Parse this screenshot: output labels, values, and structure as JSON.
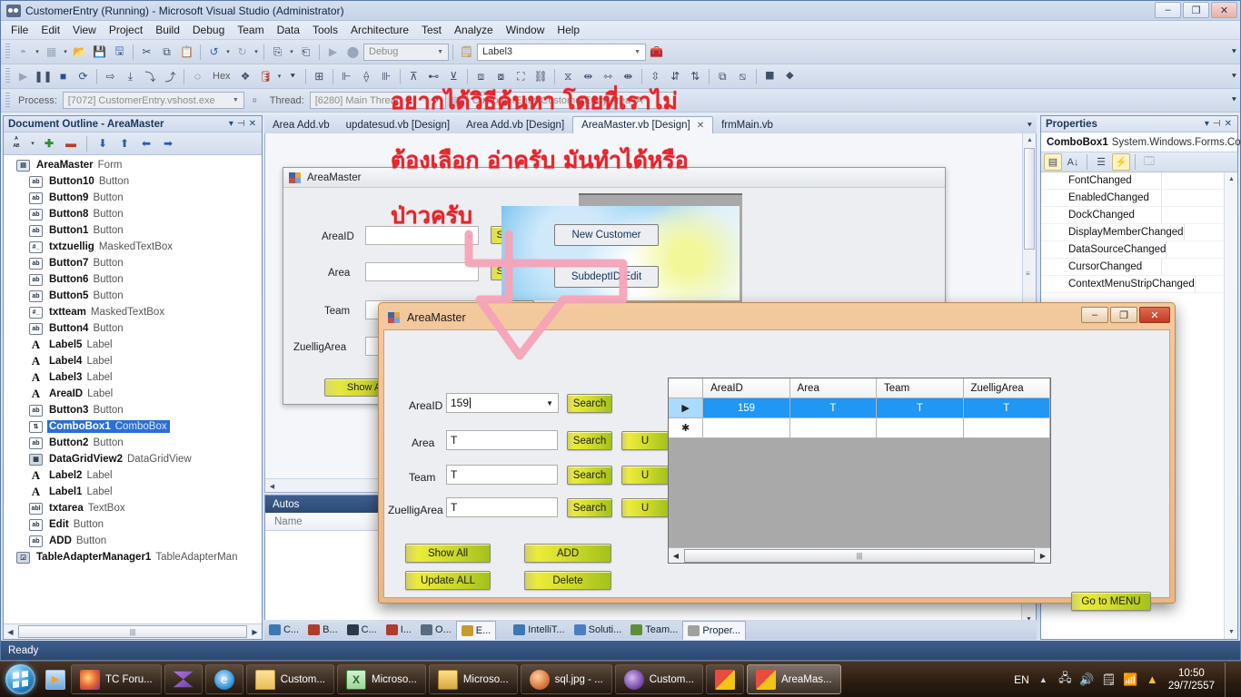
{
  "window": {
    "title": "CustomerEntry (Running) - Microsoft Visual Studio (Administrator)",
    "minimize": "–",
    "restore": "❐",
    "close": "✕"
  },
  "menubar": [
    "File",
    "Edit",
    "View",
    "Project",
    "Build",
    "Debug",
    "Team",
    "Data",
    "Tools",
    "Architecture",
    "Test",
    "Analyze",
    "Window",
    "Help"
  ],
  "toolbar_main": {
    "config_combo": "Debug",
    "target_combo": "Label3",
    "hex_label": "Hex"
  },
  "debug_bar": {
    "process_label": "Process:",
    "process_value": "[7072] CustomerEntry.vshost.exe",
    "thread_label": "Thread:",
    "thread_value": "[6280] Main Thread",
    "stackframe_value": "CustomerEntry.CustomerEntry.Area_A"
  },
  "document_outline": {
    "title": "Document Outline - AreaMaster",
    "dropdown": "▾",
    "pin": "⊣",
    "close": "✕",
    "toolbar": [
      "AB-sort",
      "add",
      "remove",
      "move-down",
      "move-up",
      "move-left",
      "move-right"
    ],
    "nodes": [
      {
        "name": "AreaMaster",
        "type": "Form",
        "icon": "form",
        "level": 0,
        "selected": false
      },
      {
        "name": "Button10",
        "type": "Button",
        "icon": "ab",
        "level": 1,
        "selected": false
      },
      {
        "name": "Button9",
        "type": "Button",
        "icon": "ab",
        "level": 1,
        "selected": false
      },
      {
        "name": "Button8",
        "type": "Button",
        "icon": "ab",
        "level": 1,
        "selected": false
      },
      {
        "name": "Button1",
        "type": "Button",
        "icon": "ab",
        "level": 1,
        "selected": false
      },
      {
        "name": "txtzuellig",
        "type": "MaskedTextBox",
        "icon": "mask",
        "level": 1,
        "selected": false
      },
      {
        "name": "Button7",
        "type": "Button",
        "icon": "ab",
        "level": 1,
        "selected": false
      },
      {
        "name": "Button6",
        "type": "Button",
        "icon": "ab",
        "level": 1,
        "selected": false
      },
      {
        "name": "Button5",
        "type": "Button",
        "icon": "ab",
        "level": 1,
        "selected": false
      },
      {
        "name": "txtteam",
        "type": "MaskedTextBox",
        "icon": "mask",
        "level": 1,
        "selected": false
      },
      {
        "name": "Button4",
        "type": "Button",
        "icon": "ab",
        "level": 1,
        "selected": false
      },
      {
        "name": "Label5",
        "type": "Label",
        "icon": "A",
        "level": 1,
        "selected": false
      },
      {
        "name": "Label4",
        "type": "Label",
        "icon": "A",
        "level": 1,
        "selected": false
      },
      {
        "name": "Label3",
        "type": "Label",
        "icon": "A",
        "level": 1,
        "selected": false
      },
      {
        "name": "AreaID",
        "type": "Label",
        "icon": "A",
        "level": 1,
        "selected": false
      },
      {
        "name": "Button3",
        "type": "Button",
        "icon": "ab",
        "level": 1,
        "selected": false
      },
      {
        "name": "ComboBox1",
        "type": "ComboBox",
        "icon": "combo",
        "level": 1,
        "selected": true
      },
      {
        "name": "Button2",
        "type": "Button",
        "icon": "ab",
        "level": 1,
        "selected": false
      },
      {
        "name": "DataGridView2",
        "type": "DataGridView",
        "icon": "grid",
        "level": 1,
        "selected": false
      },
      {
        "name": "Label2",
        "type": "Label",
        "icon": "A",
        "level": 1,
        "selected": false
      },
      {
        "name": "Label1",
        "type": "Label",
        "icon": "A",
        "level": 1,
        "selected": false
      },
      {
        "name": "txtarea",
        "type": "TextBox",
        "icon": "abl",
        "level": 1,
        "selected": false
      },
      {
        "name": "Edit",
        "type": "Button",
        "icon": "ab",
        "level": 1,
        "selected": false
      },
      {
        "name": "ADD",
        "type": "Button",
        "icon": "ab",
        "level": 1,
        "selected": false
      },
      {
        "name": "TableAdapterManager1",
        "type": "TableAdapterMan",
        "icon": "tam",
        "level": 0,
        "selected": false
      }
    ]
  },
  "editor_tabs": [
    {
      "label": "Area Add.vb",
      "active": false,
      "closable": false
    },
    {
      "label": "updatesud.vb [Design]",
      "active": false,
      "closable": false
    },
    {
      "label": "Area Add.vb [Design]",
      "active": false,
      "closable": false
    },
    {
      "label": "AreaMaster.vb [Design]",
      "active": true,
      "closable": true,
      "close": "✕"
    },
    {
      "label": "frmMain.vb",
      "active": false,
      "closable": false
    }
  ],
  "designer_form": {
    "title": "AreaMaster",
    "labels": [
      "AreaID",
      "Area",
      "Team",
      "ZuelligArea"
    ],
    "search_buttons": [
      "Search",
      "Search",
      "Search",
      "Search"
    ],
    "show_all": "Show All",
    "picture_buttons": [
      "New Customer",
      "SubdeptID Edit"
    ]
  },
  "autos_panel": {
    "title": "Autos",
    "columns": [
      "Name"
    ]
  },
  "bottom_tabs": [
    {
      "label": "C...",
      "active": false,
      "color": "#3c78b4"
    },
    {
      "label": "B...",
      "active": false,
      "color": "#b03a2e"
    },
    {
      "label": "C...",
      "active": false,
      "color": "#2b3a4a"
    },
    {
      "label": "I...",
      "active": false,
      "color": "#b03a2e"
    },
    {
      "label": "O...",
      "active": false,
      "color": "#5b6b80"
    },
    {
      "label": "E...",
      "active": true,
      "color": "#c79a2b"
    },
    {
      "label": "IntelliT...",
      "active": false,
      "color": "#3c78b4"
    },
    {
      "label": "Soluti...",
      "active": false,
      "color": "#4a7ec0"
    },
    {
      "label": "Team...",
      "active": false,
      "color": "#5b8f3a"
    },
    {
      "label": "Proper...",
      "active": true,
      "color": "#a0a0a0"
    }
  ],
  "properties": {
    "title": "Properties",
    "dropdown": "▾",
    "pin": "⊣",
    "close": "✕",
    "object_name": "ComboBox1",
    "object_type": "System.Windows.Forms.ComboBox",
    "toolbar_buttons": [
      "categorized",
      "alphabetical",
      "properties",
      "events",
      "property-pages"
    ],
    "rows": [
      "ContextMenuStripChanged",
      "CursorChanged",
      "DataSourceChanged",
      "DisplayMemberChanged",
      "DockChanged",
      "EnabledChanged",
      "FontChanged"
    ]
  },
  "status_bar": {
    "text": "Ready"
  },
  "run_dialog": {
    "title": "AreaMaster",
    "minimize": "–",
    "restore": "❐",
    "close": "✕",
    "fields": [
      {
        "label": "AreaID",
        "value": "159",
        "kind": "combo",
        "search": "Search",
        "update": null
      },
      {
        "label": "Area",
        "value": "T",
        "kind": "text",
        "search": "Search",
        "update": "U"
      },
      {
        "label": "Team",
        "value": "T",
        "kind": "text",
        "search": "Search",
        "update": "U"
      },
      {
        "label": "ZuelligArea",
        "value": "T",
        "kind": "text",
        "search": "Search",
        "update": "U"
      }
    ],
    "action_buttons": [
      {
        "label": "Show All"
      },
      {
        "label": "ADD"
      },
      {
        "label": "Update ALL"
      },
      {
        "label": "Delete"
      }
    ],
    "goto_menu": "Go to MENU",
    "grid": {
      "columns": [
        "",
        "AreaID",
        "Area",
        "Team",
        "ZuelligArea"
      ],
      "rows": [
        {
          "marker": "▶",
          "cells": [
            "159",
            "T",
            "T",
            "T"
          ],
          "selected": true
        },
        {
          "marker": "✱",
          "cells": [
            "",
            "",
            "",
            ""
          ],
          "selected": false
        }
      ]
    }
  },
  "annotations": {
    "line1": "อยากได้วิธีค้นหา โดยที่เราไม่",
    "line2": "ต้องเลือก อ่าครับ มันทำได้หรือ",
    "line3": "ป่าวครับ"
  },
  "taskbar": {
    "start": "start-orb",
    "quicklaunch": [
      "media-player-icon"
    ],
    "items": [
      {
        "label": "TC Foru...",
        "icon": "firefox",
        "active": false
      },
      {
        "label": "",
        "icon": "movie-maker",
        "active": false
      },
      {
        "label": "",
        "icon": "internet-explorer",
        "active": false
      },
      {
        "label": "Custom...",
        "icon": "folder",
        "active": false
      },
      {
        "label": "Microso...",
        "icon": "excel",
        "active": false
      },
      {
        "label": "Microso...",
        "icon": "sqlserver",
        "active": false
      },
      {
        "label": "sql.jpg - ...",
        "icon": "paint",
        "active": false
      },
      {
        "label": "Custom...",
        "icon": "visualstudio",
        "active": false
      },
      {
        "label": "",
        "icon": "windows-tiles",
        "active": false
      },
      {
        "label": "AreaMas...",
        "icon": "windows-tiles",
        "active": true
      }
    ],
    "tray": {
      "language": "EN",
      "show_hidden": "▲",
      "icons": [
        "network-icon",
        "volume-icon",
        "action-center-icon",
        "signal-icon",
        "drive-icon"
      ],
      "time": "10:50",
      "date": "29/7/2557"
    }
  }
}
